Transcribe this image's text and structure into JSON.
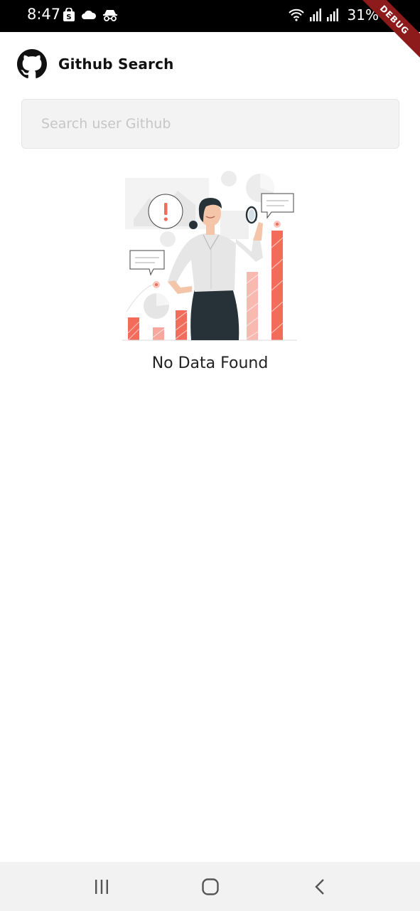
{
  "status_bar": {
    "time": "8:47",
    "battery": "31%",
    "left_icons": [
      "shopping-bag-icon",
      "cloud-icon",
      "incognito-icon"
    ],
    "right_icons": [
      "wifi-icon",
      "signal-icon",
      "signal-icon"
    ]
  },
  "debug_ribbon": {
    "label": "DEBUG",
    "color": "#8e1b1b"
  },
  "app_bar": {
    "logo_icon": "github-icon",
    "title": "Github Search"
  },
  "search": {
    "value": "",
    "placeholder": "Search user Github"
  },
  "empty_state": {
    "illustration": "woman-with-magnifier-illustration",
    "message": "No Data Found",
    "accent_color": "#f26b5b"
  },
  "nav_bar": {
    "buttons": [
      "recent-apps-icon",
      "home-icon",
      "back-icon"
    ]
  }
}
